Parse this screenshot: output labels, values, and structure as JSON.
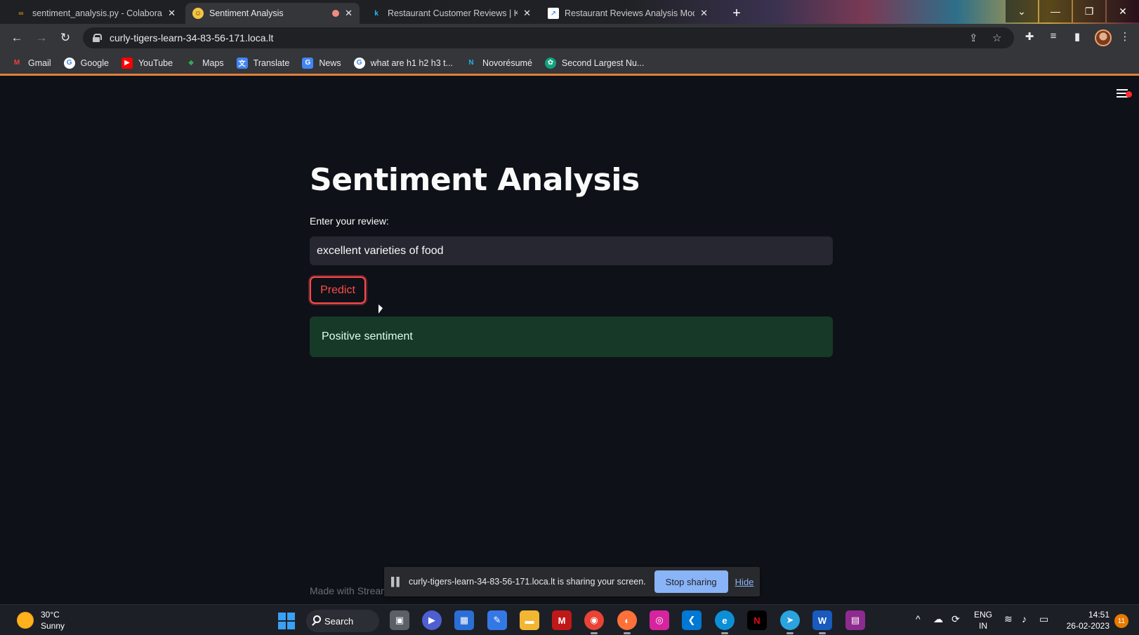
{
  "browser": {
    "tabs": [
      {
        "title": "sentiment_analysis.py - Colabora",
        "favicon": "colab-icon",
        "active": false
      },
      {
        "title": "Sentiment Analysis",
        "favicon": "emoji-icon",
        "active": true
      },
      {
        "title": "Restaurant Customer Reviews | K",
        "favicon": "kaggle-icon",
        "active": false
      },
      {
        "title": "Restaurant Reviews Analysis Mod",
        "favicon": "chart-icon",
        "active": false
      }
    ],
    "url": "curly-tigers-learn-34-83-56-171.loca.lt",
    "bookmarks": [
      {
        "label": "Gmail"
      },
      {
        "label": "Google"
      },
      {
        "label": "YouTube"
      },
      {
        "label": "Maps"
      },
      {
        "label": "Translate"
      },
      {
        "label": "News"
      },
      {
        "label": "what are h1 h2 h3 t..."
      },
      {
        "label": "Novorésumé"
      },
      {
        "label": "Second Largest Nu..."
      }
    ]
  },
  "app": {
    "title": "Sentiment Analysis",
    "input_label": "Enter your review:",
    "input_value": "excellent varieties of food",
    "predict_label": "Predict",
    "result_text": "Positive sentiment",
    "footer": "Made with Stream",
    "accent_color": "#ff4b4b",
    "success_bg": "#173928"
  },
  "sharing": {
    "message": "curly-tigers-learn-34-83-56-171.loca.lt is sharing your screen.",
    "stop_label": "Stop sharing",
    "hide_label": "Hide"
  },
  "taskbar": {
    "weather_temp": "30°C",
    "weather_desc": "Sunny",
    "search_label": "Search",
    "lang_top": "ENG",
    "lang_bottom": "IN",
    "time": "14:51",
    "date": "26-02-2023",
    "notifications": "11"
  }
}
